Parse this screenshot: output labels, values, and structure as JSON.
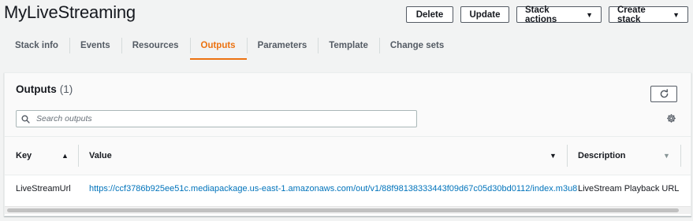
{
  "stack": {
    "title": "MyLiveStreaming"
  },
  "actions": {
    "delete": "Delete",
    "update": "Update",
    "stack_actions": "Stack actions",
    "create_stack": "Create stack"
  },
  "tabs": [
    {
      "label": "Stack info",
      "active": false
    },
    {
      "label": "Events",
      "active": false
    },
    {
      "label": "Resources",
      "active": false
    },
    {
      "label": "Outputs",
      "active": true
    },
    {
      "label": "Parameters",
      "active": false
    },
    {
      "label": "Template",
      "active": false
    },
    {
      "label": "Change sets",
      "active": false
    }
  ],
  "outputs": {
    "title": "Outputs",
    "count": "(1)",
    "search_placeholder": "Search outputs",
    "columns": {
      "key": "Key",
      "value": "Value",
      "description": "Description"
    },
    "rows": [
      {
        "key": "LiveStreamUrl",
        "value": "https://ccf3786b925ee51c.mediapackage.us-east-1.amazonaws.com/out/v1/88f98138333443f09d67c05d30bd0112/index.m3u8",
        "description": "LiveStream Playback URL"
      }
    ]
  },
  "icons": {
    "refresh": "refresh-icon",
    "search": "search-icon",
    "settings": "gear-icon",
    "sort_asc": "sort-ascending-icon",
    "sort_desc": "sort-descending-icon"
  },
  "colors": {
    "accent": "#ec7211",
    "link": "#0073bb",
    "text": "#16191f"
  }
}
